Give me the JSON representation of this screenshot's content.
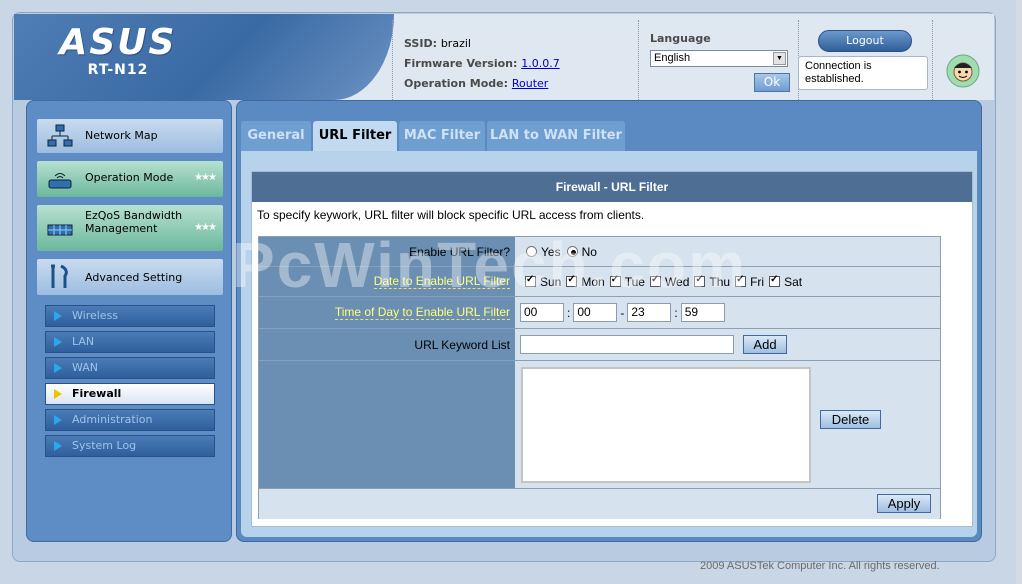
{
  "header": {
    "brand": "ASUS",
    "model": "RT-N12",
    "ssid_label": "SSID:",
    "ssid_value": "brazil",
    "firmware_label": "Firmware Version:",
    "firmware_value": "1.0.0.7",
    "opmode_label": "Operation Mode:",
    "opmode_value": "Router",
    "language_label": "Language",
    "language_value": "English",
    "ok_label": "Ok",
    "logout_label": "Logout",
    "connection_status": "Connection is established."
  },
  "sidebar": {
    "main_items": [
      {
        "label": "Network Map",
        "icon": "network-map-icon"
      },
      {
        "label": "Operation Mode",
        "icon": "router-icon"
      },
      {
        "label": "EzQoS Bandwidth Management",
        "icon": "bandwidth-icon"
      },
      {
        "label": "Advanced Setting",
        "icon": "tools-icon"
      }
    ],
    "sub_items": [
      "Wireless",
      "LAN",
      "WAN",
      "Firewall",
      "Administration",
      "System Log"
    ],
    "active_sub": "Firewall"
  },
  "tabs": [
    "General",
    "URL Filter",
    "MAC Filter",
    "LAN to WAN Filter"
  ],
  "active_tab": "URL Filter",
  "panel": {
    "title": "Firewall - URL Filter",
    "description": "To specify keywork, URL filter will block specific URL access from clients.",
    "enable_label": "Enable URL Filter?",
    "enable_options": [
      "Yes",
      "No"
    ],
    "enable_selected": "No",
    "date_label": "Date to Enable URL Filter",
    "days": [
      "Sun",
      "Mon",
      "Tue",
      "Wed",
      "Thu",
      "Fri",
      "Sat"
    ],
    "days_checked": [
      true,
      true,
      true,
      true,
      true,
      true,
      true
    ],
    "time_label": "Time of Day to Enable URL Filter",
    "time_start_hour": "00",
    "time_start_min": "00",
    "time_end_hour": "23",
    "time_end_min": "59",
    "time_sep_colon": ":",
    "time_sep_dash": "-",
    "keyword_label": "URL Keyword List",
    "keyword_value": "",
    "add_label": "Add",
    "delete_label": "Delete",
    "apply_label": "Apply"
  },
  "help_icon": "?",
  "footer": "2009 ASUSTek Computer Inc. All rights reserved.",
  "watermark": "PcWinTech.com",
  "colors": {
    "brand_blue": "#3a6aa4",
    "panel_title_bg": "#4e6f93",
    "label_bg": "#6b8fb3",
    "highlight_label": "#ffff7a"
  }
}
